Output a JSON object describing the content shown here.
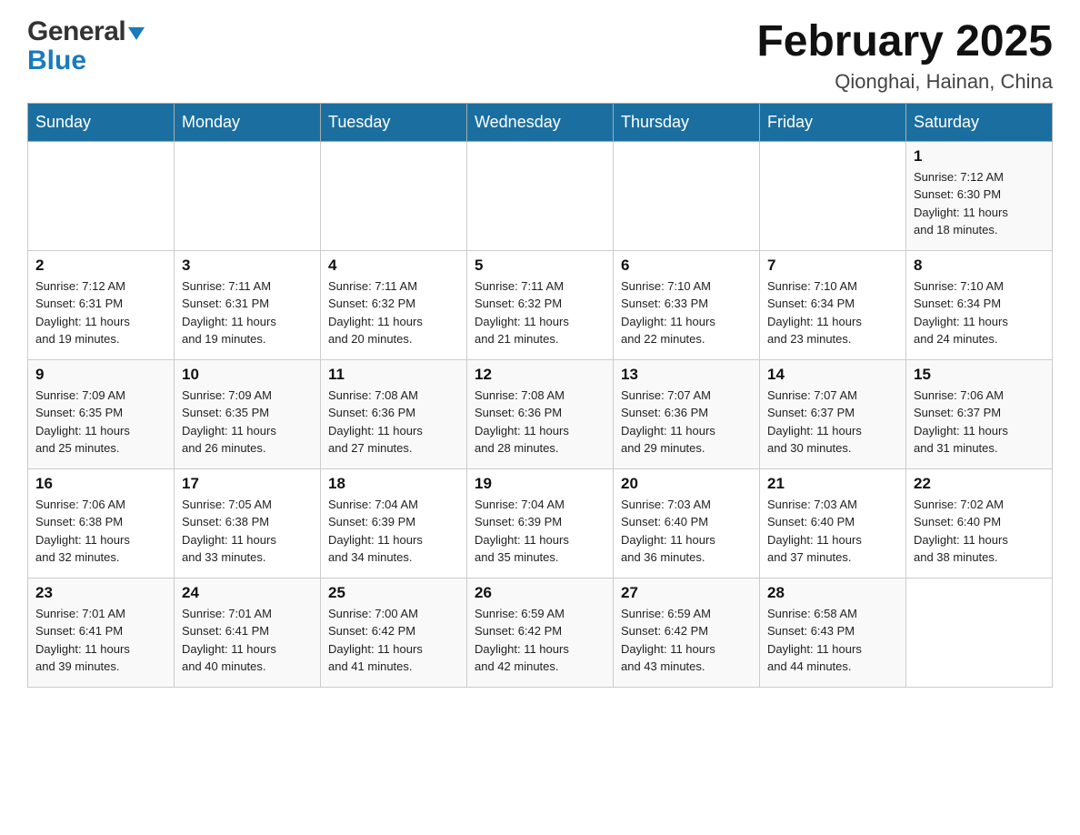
{
  "logo": {
    "part1": "General",
    "part2": "Blue"
  },
  "title": {
    "month_year": "February 2025",
    "location": "Qionghai, Hainan, China"
  },
  "days_of_week": [
    "Sunday",
    "Monday",
    "Tuesday",
    "Wednesday",
    "Thursday",
    "Friday",
    "Saturday"
  ],
  "weeks": [
    [
      {
        "day": "",
        "info": ""
      },
      {
        "day": "",
        "info": ""
      },
      {
        "day": "",
        "info": ""
      },
      {
        "day": "",
        "info": ""
      },
      {
        "day": "",
        "info": ""
      },
      {
        "day": "",
        "info": ""
      },
      {
        "day": "1",
        "info": "Sunrise: 7:12 AM\nSunset: 6:30 PM\nDaylight: 11 hours\nand 18 minutes."
      }
    ],
    [
      {
        "day": "2",
        "info": "Sunrise: 7:12 AM\nSunset: 6:31 PM\nDaylight: 11 hours\nand 19 minutes."
      },
      {
        "day": "3",
        "info": "Sunrise: 7:11 AM\nSunset: 6:31 PM\nDaylight: 11 hours\nand 19 minutes."
      },
      {
        "day": "4",
        "info": "Sunrise: 7:11 AM\nSunset: 6:32 PM\nDaylight: 11 hours\nand 20 minutes."
      },
      {
        "day": "5",
        "info": "Sunrise: 7:11 AM\nSunset: 6:32 PM\nDaylight: 11 hours\nand 21 minutes."
      },
      {
        "day": "6",
        "info": "Sunrise: 7:10 AM\nSunset: 6:33 PM\nDaylight: 11 hours\nand 22 minutes."
      },
      {
        "day": "7",
        "info": "Sunrise: 7:10 AM\nSunset: 6:34 PM\nDaylight: 11 hours\nand 23 minutes."
      },
      {
        "day": "8",
        "info": "Sunrise: 7:10 AM\nSunset: 6:34 PM\nDaylight: 11 hours\nand 24 minutes."
      }
    ],
    [
      {
        "day": "9",
        "info": "Sunrise: 7:09 AM\nSunset: 6:35 PM\nDaylight: 11 hours\nand 25 minutes."
      },
      {
        "day": "10",
        "info": "Sunrise: 7:09 AM\nSunset: 6:35 PM\nDaylight: 11 hours\nand 26 minutes."
      },
      {
        "day": "11",
        "info": "Sunrise: 7:08 AM\nSunset: 6:36 PM\nDaylight: 11 hours\nand 27 minutes."
      },
      {
        "day": "12",
        "info": "Sunrise: 7:08 AM\nSunset: 6:36 PM\nDaylight: 11 hours\nand 28 minutes."
      },
      {
        "day": "13",
        "info": "Sunrise: 7:07 AM\nSunset: 6:36 PM\nDaylight: 11 hours\nand 29 minutes."
      },
      {
        "day": "14",
        "info": "Sunrise: 7:07 AM\nSunset: 6:37 PM\nDaylight: 11 hours\nand 30 minutes."
      },
      {
        "day": "15",
        "info": "Sunrise: 7:06 AM\nSunset: 6:37 PM\nDaylight: 11 hours\nand 31 minutes."
      }
    ],
    [
      {
        "day": "16",
        "info": "Sunrise: 7:06 AM\nSunset: 6:38 PM\nDaylight: 11 hours\nand 32 minutes."
      },
      {
        "day": "17",
        "info": "Sunrise: 7:05 AM\nSunset: 6:38 PM\nDaylight: 11 hours\nand 33 minutes."
      },
      {
        "day": "18",
        "info": "Sunrise: 7:04 AM\nSunset: 6:39 PM\nDaylight: 11 hours\nand 34 minutes."
      },
      {
        "day": "19",
        "info": "Sunrise: 7:04 AM\nSunset: 6:39 PM\nDaylight: 11 hours\nand 35 minutes."
      },
      {
        "day": "20",
        "info": "Sunrise: 7:03 AM\nSunset: 6:40 PM\nDaylight: 11 hours\nand 36 minutes."
      },
      {
        "day": "21",
        "info": "Sunrise: 7:03 AM\nSunset: 6:40 PM\nDaylight: 11 hours\nand 37 minutes."
      },
      {
        "day": "22",
        "info": "Sunrise: 7:02 AM\nSunset: 6:40 PM\nDaylight: 11 hours\nand 38 minutes."
      }
    ],
    [
      {
        "day": "23",
        "info": "Sunrise: 7:01 AM\nSunset: 6:41 PM\nDaylight: 11 hours\nand 39 minutes."
      },
      {
        "day": "24",
        "info": "Sunrise: 7:01 AM\nSunset: 6:41 PM\nDaylight: 11 hours\nand 40 minutes."
      },
      {
        "day": "25",
        "info": "Sunrise: 7:00 AM\nSunset: 6:42 PM\nDaylight: 11 hours\nand 41 minutes."
      },
      {
        "day": "26",
        "info": "Sunrise: 6:59 AM\nSunset: 6:42 PM\nDaylight: 11 hours\nand 42 minutes."
      },
      {
        "day": "27",
        "info": "Sunrise: 6:59 AM\nSunset: 6:42 PM\nDaylight: 11 hours\nand 43 minutes."
      },
      {
        "day": "28",
        "info": "Sunrise: 6:58 AM\nSunset: 6:43 PM\nDaylight: 11 hours\nand 44 minutes."
      },
      {
        "day": "",
        "info": ""
      }
    ]
  ]
}
